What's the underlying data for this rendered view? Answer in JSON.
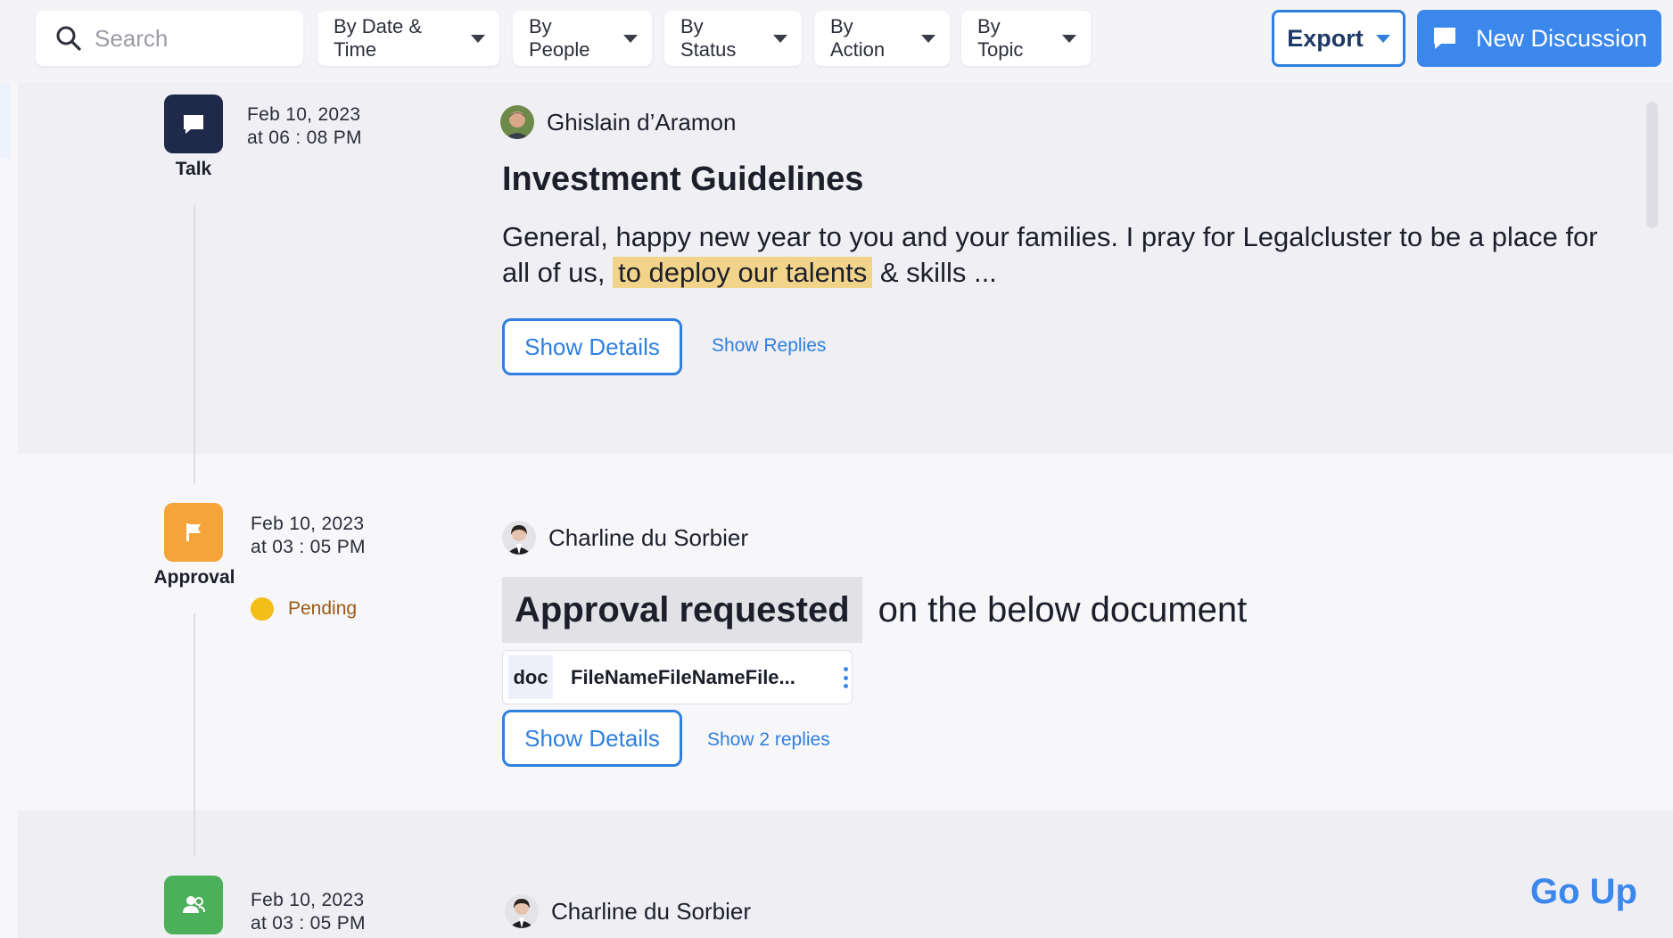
{
  "toolbar": {
    "search_placeholder": "Search",
    "filters": [
      {
        "label": "By Date & Time"
      },
      {
        "label": "By People"
      },
      {
        "label": "By Status"
      },
      {
        "label": "By Action"
      },
      {
        "label": "By Topic"
      }
    ],
    "export_label": "Export",
    "new_discussion_label": "New Discussion"
  },
  "posts": [
    {
      "type": "Talk",
      "type_icon": "chat-bubble-icon",
      "type_color": "#1f2a4a",
      "date": "Feb 10, 2023",
      "time": "at 06 : 08 PM",
      "author": "Ghislain d’Aramon",
      "title": "Investment Guidelines",
      "body_before": "General, happy new year to you and your families. I pray for Legalcluster to be a place for all of us,",
      "body_highlight": "to deploy our talents",
      "body_after": "& skills ...",
      "show_details_label": "Show Details",
      "replies_label": "Show Replies"
    },
    {
      "type": "Approval",
      "type_icon": "flag-icon",
      "type_color": "#f5a43a",
      "date": "Feb 10, 2023",
      "time": "at 03 : 05 PM",
      "status": "Pending",
      "status_color": "#f5bd18",
      "author": "Charline du Sorbier",
      "approval_tag": "Approval requested",
      "approval_rest": "on the below document",
      "doc_ext": "doc",
      "doc_name": "FileNameFileNameFile...",
      "show_details_label": "Show Details",
      "replies_label": "Show 2 replies"
    },
    {
      "type_icon": "people-icon",
      "type_color": "#4caf5a",
      "date": "Feb 10, 2023",
      "time": "at 03 : 05 PM",
      "author": "Charline du Sorbier"
    }
  ],
  "go_up_label": "Go Up",
  "accent_color": "#3b87ec"
}
